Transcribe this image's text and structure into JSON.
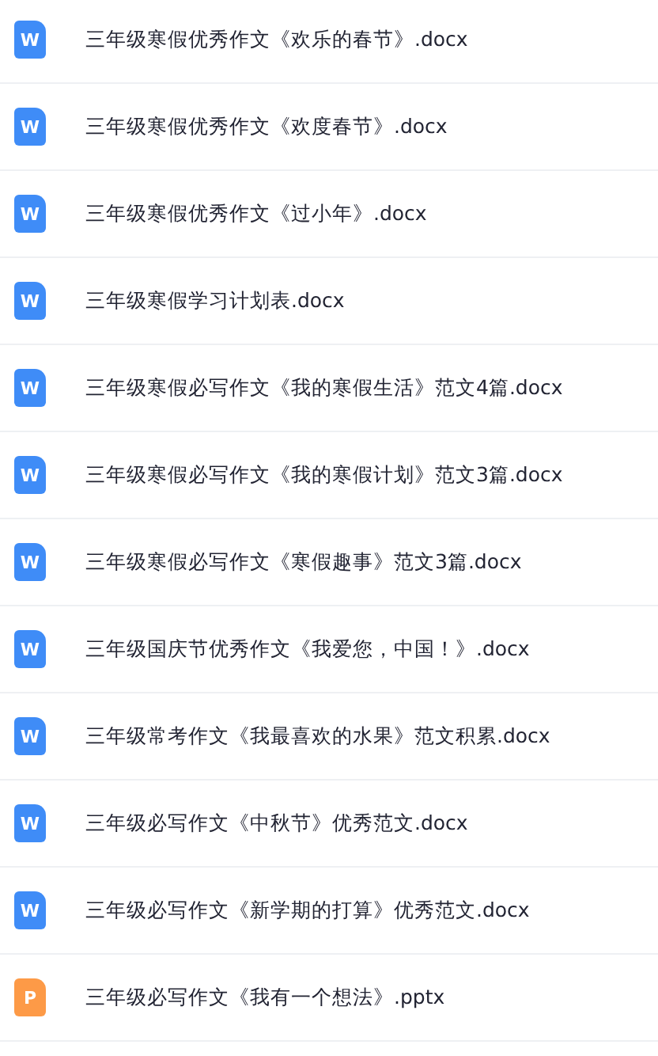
{
  "files": [
    {
      "kind": "docx",
      "icon_letter": "W",
      "name": "三年级寒假优秀作文《欢乐的春节》.docx"
    },
    {
      "kind": "docx",
      "icon_letter": "W",
      "name": "三年级寒假优秀作文《欢度春节》.docx"
    },
    {
      "kind": "docx",
      "icon_letter": "W",
      "name": "三年级寒假优秀作文《过小年》.docx"
    },
    {
      "kind": "docx",
      "icon_letter": "W",
      "name": "三年级寒假学习计划表.docx"
    },
    {
      "kind": "docx",
      "icon_letter": "W",
      "name": "三年级寒假必写作文《我的寒假生活》范文4篇.docx"
    },
    {
      "kind": "docx",
      "icon_letter": "W",
      "name": "三年级寒假必写作文《我的寒假计划》范文3篇.docx"
    },
    {
      "kind": "docx",
      "icon_letter": "W",
      "name": "三年级寒假必写作文《寒假趣事》范文3篇.docx"
    },
    {
      "kind": "docx",
      "icon_letter": "W",
      "name": "三年级国庆节优秀作文《我爱您，中国！》.docx"
    },
    {
      "kind": "docx",
      "icon_letter": "W",
      "name": "三年级常考作文《我最喜欢的水果》范文积累.docx"
    },
    {
      "kind": "docx",
      "icon_letter": "W",
      "name": "三年级必写作文《中秋节》优秀范文.docx"
    },
    {
      "kind": "docx",
      "icon_letter": "W",
      "name": "三年级必写作文《新学期的打算》优秀范文.docx"
    },
    {
      "kind": "pptx",
      "icon_letter": "P",
      "name": "三年级必写作文《我有一个想法》.pptx"
    }
  ]
}
